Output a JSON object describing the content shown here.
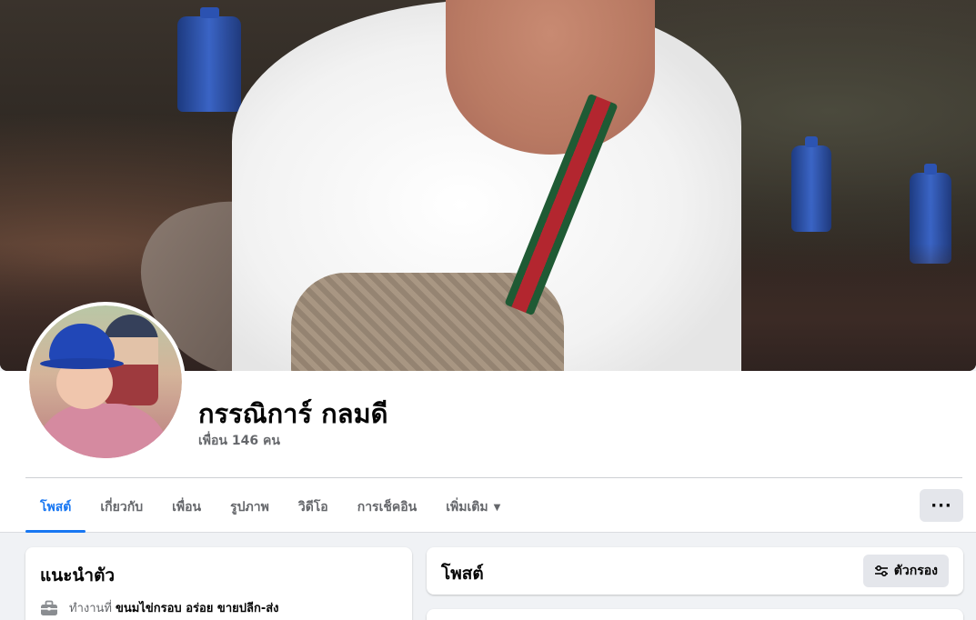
{
  "profile": {
    "name": "กรรณิการ์ กลมดี",
    "friends_text": "เพื่อน 146 คน"
  },
  "tabs": [
    {
      "label": "โพสต์",
      "active": true
    },
    {
      "label": "เกี่ยวกับ",
      "active": false
    },
    {
      "label": "เพื่อน",
      "active": false
    },
    {
      "label": "รูปภาพ",
      "active": false
    },
    {
      "label": "วิดีโอ",
      "active": false
    },
    {
      "label": "การเช็คอิน",
      "active": false
    },
    {
      "label": "เพิ่มเติม",
      "active": false
    }
  ],
  "more_button": {
    "label": "···",
    "icon": "more-horizontal-icon"
  },
  "intro": {
    "title": "แนะนำตัว",
    "work_prefix": "ทำงานที่",
    "workplace": "ขนมไข่กรอบ อร่อย ขายปลีก-ส่ง",
    "icon": "briefcase-icon"
  },
  "posts": {
    "title": "โพสต์",
    "filter_label": "ตัวกรอง",
    "filter_icon": "filter-sliders-icon"
  },
  "colors": {
    "accent": "#1877f2",
    "muted_text": "#65676b",
    "button_bg": "#e4e6eb",
    "page_bg": "#f0f2f5"
  }
}
